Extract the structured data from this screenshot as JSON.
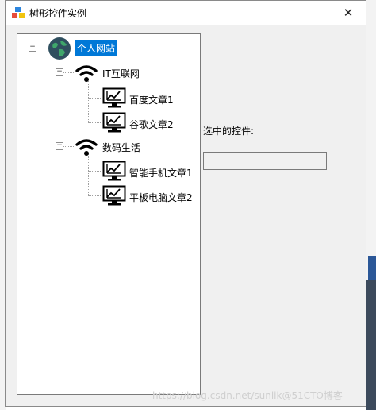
{
  "window": {
    "title": "树形控件实例",
    "close_glyph": "✕"
  },
  "tree": {
    "root": {
      "label": "个人网站",
      "icon": "globe-icon",
      "expander": "−"
    },
    "groups": [
      {
        "label": "IT互联网",
        "icon": "wifi-icon",
        "expander": "−",
        "items": [
          {
            "label": "百度文章1",
            "icon": "monitor-chart-icon"
          },
          {
            "label": "谷歌文章2",
            "icon": "monitor-chart-icon"
          }
        ]
      },
      {
        "label": "数码生活",
        "icon": "wifi-icon",
        "expander": "−",
        "items": [
          {
            "label": "智能手机文章1",
            "icon": "monitor-chart-icon"
          },
          {
            "label": "平板电脑文章2",
            "icon": "monitor-chart-icon"
          }
        ]
      }
    ]
  },
  "status": {
    "label": "选中的控件:",
    "value": ""
  },
  "watermark": "https://blog.csdn.net/sunlik@51CTO博客",
  "colors": {
    "selection": "#0078d7",
    "window_bg": "#f0f0f0",
    "tree_bg": "#ffffff"
  }
}
